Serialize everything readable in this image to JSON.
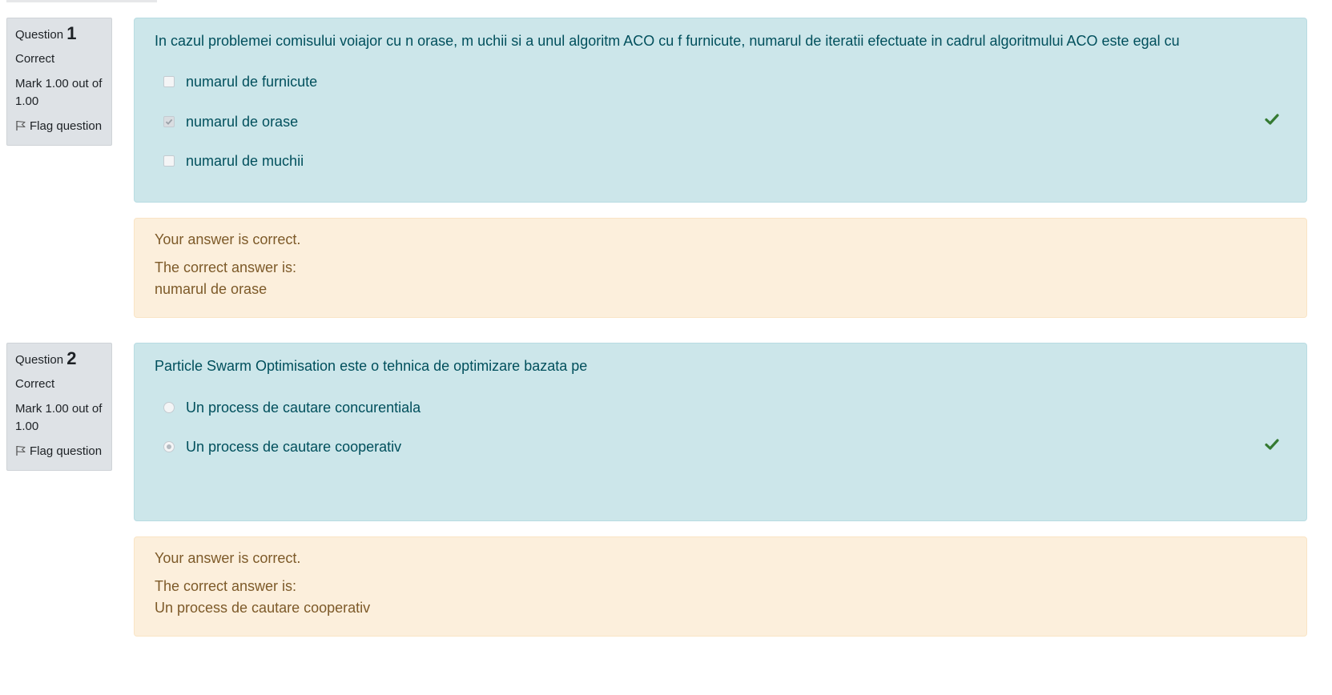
{
  "colors": {
    "info_bg": "#dee2e6",
    "formulation_bg": "#cce6ea",
    "formulation_text": "#004f5c",
    "feedback_bg": "#fcefdc",
    "feedback_text": "#7d5a29",
    "correct_tick": "#357a32"
  },
  "questions": [
    {
      "label": "Question",
      "number": "1",
      "state": "Correct",
      "grade": "Mark 1.00 out of 1.00",
      "flag_label": "Flag question",
      "flag_icon": "flag-icon",
      "text": "In cazul problemei comisului voiajor cu n orase, m uchii si a unul algoritm ACO cu f furnicute, numarul de iteratii efectuate in cadrul algoritmului ACO este egal cu",
      "input_type": "checkbox",
      "answers": [
        {
          "label": "numarul de furnicute",
          "selected": false
        },
        {
          "label": "numarul de orase",
          "selected": true,
          "correct_mark": "check-icon"
        },
        {
          "label": "numarul de muchii",
          "selected": false
        }
      ],
      "feedback": {
        "status": "Your answer is correct.",
        "right_answer_label": "The correct answer is:",
        "right_answer": "numarul de orase"
      }
    },
    {
      "label": "Question",
      "number": "2",
      "state": "Correct",
      "grade": "Mark 1.00 out of 1.00",
      "flag_label": "Flag question",
      "flag_icon": "flag-icon",
      "text": "Particle Swarm Optimisation este o tehnica de optimizare bazata pe",
      "input_type": "radio",
      "answers": [
        {
          "label": "Un process de cautare concurentiala",
          "selected": false
        },
        {
          "label": "Un process de cautare cooperativ",
          "selected": true,
          "correct_mark": "check-icon"
        }
      ],
      "feedback": {
        "status": "Your answer is correct.",
        "right_answer_label": "The correct answer is:",
        "right_answer": "Un process de cautare cooperativ"
      }
    }
  ]
}
